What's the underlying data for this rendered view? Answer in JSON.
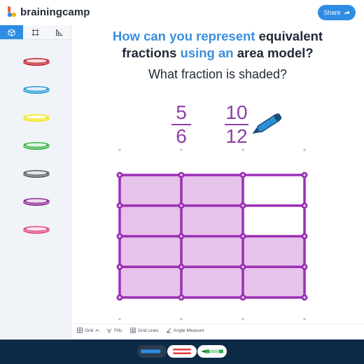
{
  "app": {
    "brand": "brainingcamp",
    "share_label": "Share"
  },
  "question": {
    "line1_a": "How can you represent ",
    "line1_b": "equivalent",
    "line2_a": "fractions ",
    "line2_b": "using an",
    "line2_c": " area model?",
    "subtitle": "What fraction is shaded?"
  },
  "fractions": [
    {
      "numerator": "5",
      "denominator": "6"
    },
    {
      "numerator": "10",
      "denominator": "12"
    }
  ],
  "area_model": {
    "rows": 4,
    "cols": 3,
    "shaded_cells": 10,
    "total_cells": 12,
    "shade_color": "#e6c3ea",
    "line_color": "#9b2fb5"
  },
  "sidebar": {
    "tabs": [
      {
        "icon": "cube-icon"
      },
      {
        "icon": "frame-icon"
      },
      {
        "icon": "angle-icon"
      }
    ],
    "markers": [
      {
        "name": "red-marker",
        "color": "#c2202f"
      },
      {
        "name": "blue-marker",
        "color": "#2b9ad8"
      },
      {
        "name": "yellow-marker",
        "color": "#f2e41f"
      },
      {
        "name": "green-marker",
        "color": "#38b54a"
      },
      {
        "name": "gray-marker",
        "color": "#555a61"
      },
      {
        "name": "purple-marker",
        "color": "#8e2796"
      },
      {
        "name": "pink-marker",
        "color": "#e2457f"
      }
    ]
  },
  "bottom_tools": [
    {
      "label": "Grid",
      "icon": "grid-icon"
    },
    {
      "label": "Fills",
      "icon": "fill-icon"
    },
    {
      "label": "Grid Lines",
      "icon": "grid-lines-icon"
    },
    {
      "label": "Angle Measure",
      "icon": "angle-measure-icon"
    }
  ],
  "footer_tools": [
    {
      "name": "pen-tool",
      "color": "#2f8de4"
    },
    {
      "name": "eraser-tool",
      "color": "#e23b3b"
    },
    {
      "name": "highlighter-tool",
      "color": "#2fa84f"
    }
  ]
}
